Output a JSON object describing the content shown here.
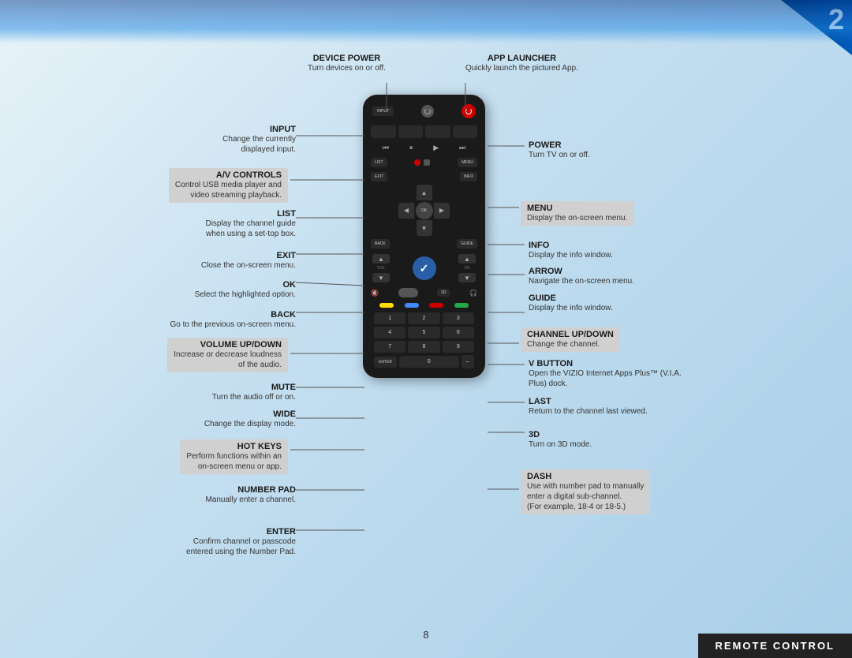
{
  "page": {
    "number": "8",
    "corner_badge": "2"
  },
  "footer": {
    "label": "REMOTE CONTROL"
  },
  "annotations": {
    "top": [
      {
        "id": "device-power",
        "title": "DEVICE POWER",
        "desc": "Turn devices on or off."
      },
      {
        "id": "app-launcher",
        "title": "APP LAUNCHER",
        "desc": "Quickly launch the pictured App."
      }
    ],
    "left": [
      {
        "id": "input",
        "title": "INPUT",
        "desc": "Change the currently\ndisplayed input.",
        "highlighted": false
      },
      {
        "id": "av-controls",
        "title": "A/V CONTROLS",
        "desc": "Control USB media player and\nvideo streaming playback.",
        "highlighted": true
      },
      {
        "id": "list",
        "title": "LIST",
        "desc": "Display the channel guide\nwhen using a set-top box.",
        "highlighted": false
      },
      {
        "id": "exit",
        "title": "EXIT",
        "desc": "Close the on-screen menu.",
        "highlighted": false
      },
      {
        "id": "ok",
        "title": "OK",
        "desc": "Select the highlighted option.",
        "highlighted": false
      },
      {
        "id": "back",
        "title": "BACK",
        "desc": "Go to the previous on-screen menu.",
        "highlighted": false
      },
      {
        "id": "volume-updown",
        "title": "VOLUME UP/DOWN",
        "desc": "Increase or decrease loudness\nof the audio.",
        "highlighted": true
      },
      {
        "id": "mute",
        "title": "MUTE",
        "desc": "Turn the audio off or on.",
        "highlighted": false
      },
      {
        "id": "wide",
        "title": "WIDE",
        "desc": "Change the display mode.",
        "highlighted": false
      },
      {
        "id": "hot-keys",
        "title": "HOT KEYS",
        "desc": "Perform functions within an\non-screen menu or app.",
        "highlighted": true
      },
      {
        "id": "number-pad",
        "title": "NUMBER PAD",
        "desc": "Manually enter a channel.",
        "highlighted": false
      },
      {
        "id": "enter",
        "title": "ENTER",
        "desc": "Confirm channel or passcode\nentered using the Number Pad.",
        "highlighted": false
      }
    ],
    "right": [
      {
        "id": "power",
        "title": "POWER",
        "desc": "Turn TV on or off.",
        "highlighted": false
      },
      {
        "id": "menu",
        "title": "MENU",
        "desc": "Display the on-screen menu.",
        "highlighted": true
      },
      {
        "id": "info",
        "title": "INFO",
        "desc": "Display the info window.",
        "highlighted": false
      },
      {
        "id": "arrow",
        "title": "ARROW",
        "desc": "Navigate the on-screen menu.",
        "highlighted": false
      },
      {
        "id": "guide",
        "title": "GUIDE",
        "desc": "Display the info window.",
        "highlighted": false
      },
      {
        "id": "channel-updown",
        "title": "CHANNEL UP/DOWN",
        "desc": "Change the channel.",
        "highlighted": true
      },
      {
        "id": "v-button",
        "title": "V BUTTON",
        "desc": "Open the VIZIO Internet Apps Plus™ (V.I.A.\nPlus) dock.",
        "highlighted": false
      },
      {
        "id": "last",
        "title": "LAST",
        "desc": "Return to the channel last viewed.",
        "highlighted": false
      },
      {
        "id": "3d",
        "title": "3D",
        "desc": "Turn on 3D mode.",
        "highlighted": false
      },
      {
        "id": "dash",
        "title": "DASH",
        "desc": "Use with number pad to manually\nenter a digital sub-channel.\n(For example, 18-4 or 18-5.)",
        "highlighted": true
      }
    ]
  },
  "remote": {
    "input_label": "INPUT",
    "power_label": "POWER",
    "list_label": "LIST",
    "menu_label": "MENU",
    "exit_label": "EXIT",
    "info_label": "INFO",
    "ok_label": "OK",
    "back_label": "BACK",
    "guide_label": "GUIDE",
    "vol_label": "VOL",
    "ch_label": "CH",
    "btn_3d_label": "3D",
    "enter_label": "ENTER",
    "numbers": [
      "1",
      "2",
      "3",
      "4",
      "5",
      "6",
      "7",
      "8",
      "9"
    ],
    "zero": "0",
    "v_symbol": "✓",
    "colors": [
      "#ffdd00",
      "#4488ff",
      "#cc0000",
      "#22aa44"
    ]
  }
}
